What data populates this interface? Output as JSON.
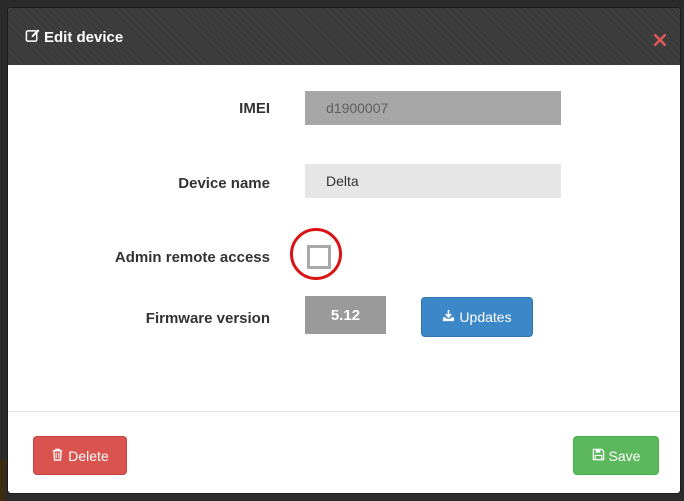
{
  "modal": {
    "title": "Edit device",
    "header_icon": "edit-icon",
    "close_icon": "close-icon"
  },
  "form": {
    "imei_label": "IMEI",
    "imei_value": "d1900007",
    "device_name_label": "Device name",
    "device_name_value": "Delta",
    "admin_remote_access_label": "Admin remote access",
    "admin_remote_access_checked": false,
    "firmware_label": "Firmware version",
    "firmware_value": "5.12",
    "updates_button": "Updates",
    "updates_icon": "download-icon"
  },
  "footer": {
    "delete_button": "Delete",
    "delete_icon": "trash-icon",
    "save_button": "Save",
    "save_icon": "floppy-disk-icon"
  },
  "colors": {
    "header_bg": "#3b3b3b",
    "primary": "#3c87c8",
    "danger": "#d9534f",
    "success": "#5cb85c",
    "highlight": "#d91414"
  }
}
